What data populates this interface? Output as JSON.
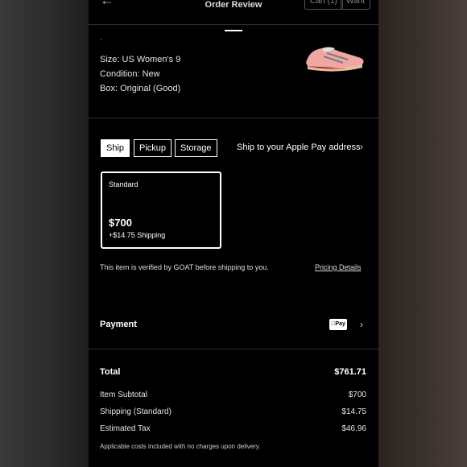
{
  "header": {
    "title": "Order Review",
    "back_icon": "←",
    "cart_label": "Cart (1)",
    "want_label": "Want"
  },
  "product": {
    "dot": "·",
    "size": "Size: US Women's 9",
    "condition": "Condition: New",
    "box": "Box: Original (Good)",
    "image_icon": "sneaker-image"
  },
  "shipping_options": [
    {
      "label": "Ship",
      "selected": true
    },
    {
      "label": "Pickup",
      "selected": false
    },
    {
      "label": "Storage",
      "selected": false
    }
  ],
  "ship_to": "Ship to your Apple Pay address",
  "chevron": "›",
  "standard": {
    "label": "Standard",
    "price": "$700",
    "shipping": "+$14.75 Shipping"
  },
  "verification_text": "This item is verified by GOAT before shipping to you.",
  "pricing_details": "Pricing Details",
  "payment": {
    "label": "Payment",
    "method": "Pay"
  },
  "summary": {
    "total_label": "Total",
    "total_value": "$761.71",
    "rows": [
      {
        "label": "Item Subtotal",
        "value": "$700"
      },
      {
        "label": "Shipping (Standard)",
        "value": "$14.75"
      },
      {
        "label": "Estimated Tax",
        "value": "$46.96"
      }
    ],
    "note": "Applicable costs included with no charges upon delivery."
  }
}
